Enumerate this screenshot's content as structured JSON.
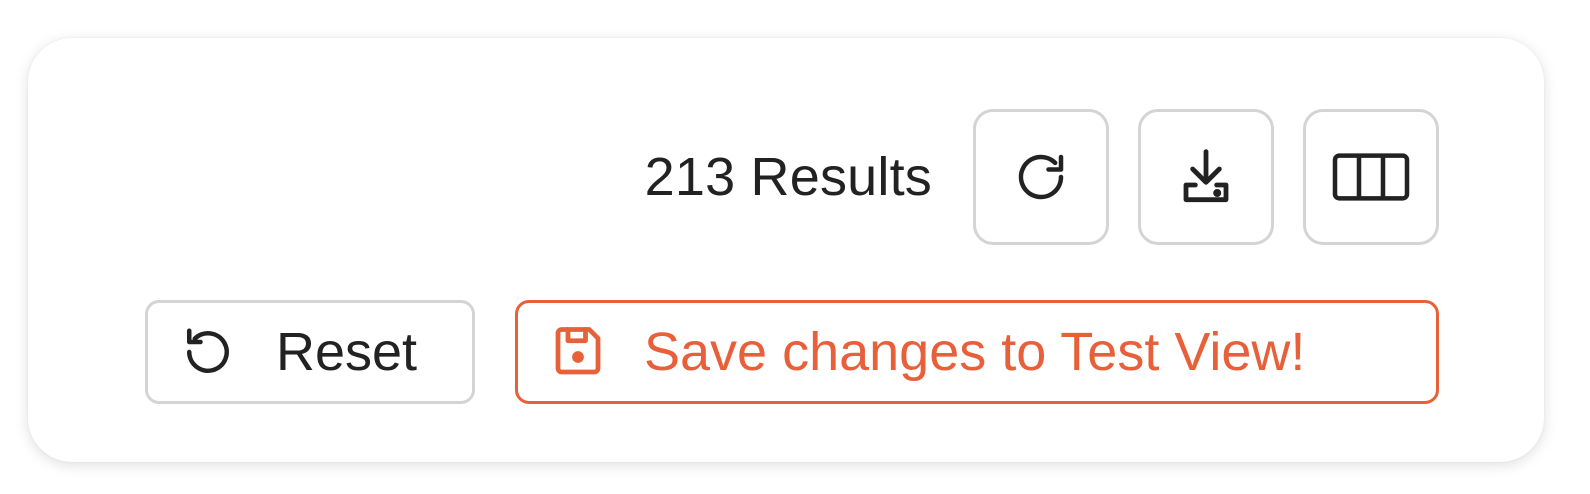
{
  "results": {
    "count_text": "213 Results"
  },
  "toolbar": {
    "refresh_icon": "refresh-icon",
    "download_icon": "download-icon",
    "columns_icon": "columns-icon"
  },
  "actions": {
    "reset_label": "Reset",
    "reset_icon": "undo-icon",
    "save_label": "Save changes to Test View!",
    "save_icon": "floppy-disk-icon"
  },
  "colors": {
    "accent": "#e8603a",
    "text": "#222222",
    "border": "#d4d4d4"
  }
}
